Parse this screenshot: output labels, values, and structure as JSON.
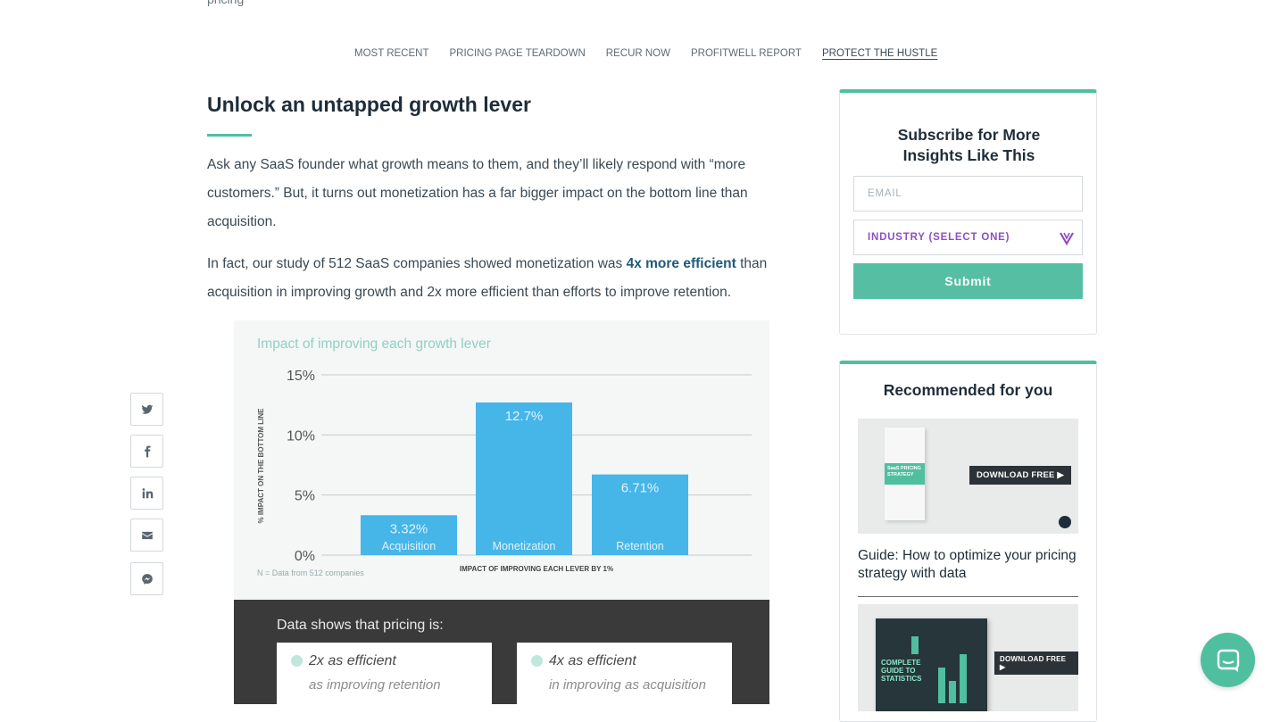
{
  "header": {
    "cut_text": "pricing"
  },
  "nav": [
    "MOST RECENT",
    "PRICING PAGE TEARDOWN",
    "RECUR NOW",
    "PROFITWELL REPORT",
    "PROTECT THE HUSTLE"
  ],
  "article": {
    "title": "Unlock an untapped growth lever",
    "p1": "Ask any SaaS founder what growth means to them, and they’ll likely respond with “more customers.” But, it turns out monetization has a far bigger impact on the bottom line than acquisition.",
    "p2_before": "In fact, our study of 512 SaaS companies showed monetization was ",
    "p2_link": "4x more efficient",
    "p2_after": " than acquisition in improving growth and 2x more efficient than efforts to improve retention."
  },
  "share": [
    "twitter-icon",
    "facebook-icon",
    "linkedin-icon",
    "email-icon",
    "messenger-icon"
  ],
  "chart_data": {
    "type": "bar",
    "title": "Impact of improving each growth lever",
    "categories": [
      "Acquisition",
      "Monetization",
      "Retention"
    ],
    "values": [
      3.32,
      12.7,
      6.71
    ],
    "value_labels": [
      "3.32%",
      "12.7%",
      "6.71%"
    ],
    "yticks": [
      "15%",
      "10%",
      "5%",
      "0%"
    ],
    "ylim": [
      0,
      15
    ],
    "ylabel": "% IMPACT ON THE BOTTOM LINE",
    "xlabel": "IMPACT OF IMPROVING EACH LEVER BY 1%",
    "note": "N = Data from 512 companies",
    "color": "#46b5e8"
  },
  "callout": {
    "title": "Data shows that pricing is:",
    "cards": [
      {
        "l1": "2x as efficient",
        "l2": "as improving retention"
      },
      {
        "l1": "4x as efficient",
        "l2": "in improving as acquisition"
      }
    ]
  },
  "subscribe": {
    "title": "Subscribe for More Insights Like This",
    "email_placeholder": "EMAIL",
    "industry_placeholder": "INDUSTRY (SELECT ONE)",
    "submit_label": "Submit"
  },
  "recommended": {
    "title": "Recommended for you",
    "items": [
      {
        "caption": "Guide: How to optimize your pricing strategy with data",
        "cover": "SaaS PRICING STRATEGY",
        "badge": "DOWNLOAD FREE ▶"
      },
      {
        "cover": "COMPLETE GUIDE TO STATISTICS",
        "badge": "DOWNLOAD FREE ▶"
      }
    ]
  },
  "colors": {
    "accent": "#4fbfa0",
    "link": "#1f5a7a",
    "purple": "#8e4fc0"
  }
}
